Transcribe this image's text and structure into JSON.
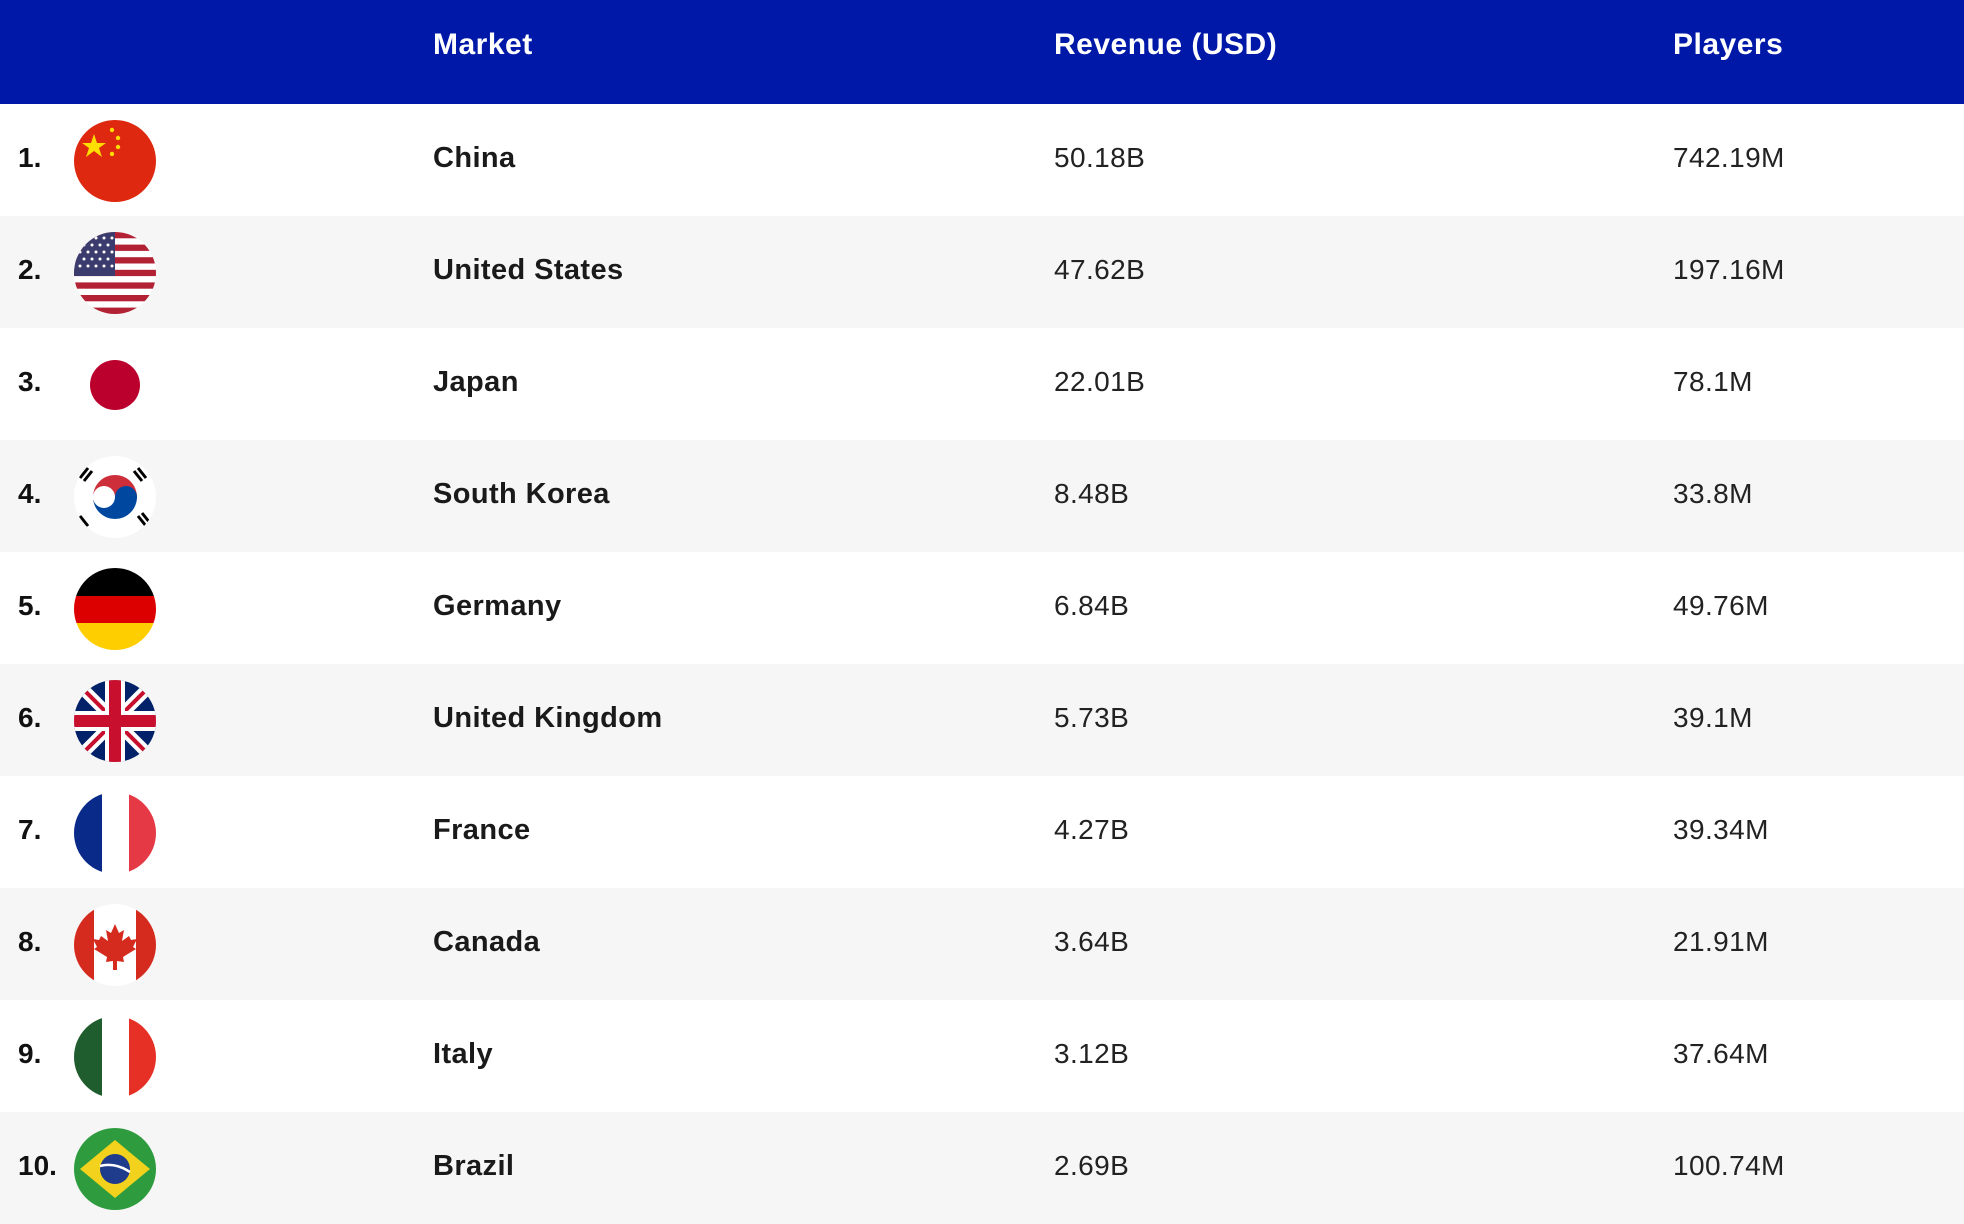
{
  "chart_data": {
    "type": "table",
    "columns": [
      "",
      "Market",
      "Revenue (USD)",
      "Players"
    ],
    "rows": [
      {
        "rank": "1.",
        "flag": "china-flag-icon",
        "market": "China",
        "revenue": "50.18B",
        "players": "742.19M"
      },
      {
        "rank": "2.",
        "flag": "united-states-flag-icon",
        "market": "United States",
        "revenue": "47.62B",
        "players": "197.16M"
      },
      {
        "rank": "3.",
        "flag": "japan-flag-icon",
        "market": "Japan",
        "revenue": "22.01B",
        "players": "78.1M"
      },
      {
        "rank": "4.",
        "flag": "south-korea-flag-icon",
        "market": "South Korea",
        "revenue": "8.48B",
        "players": "33.8M"
      },
      {
        "rank": "5.",
        "flag": "germany-flag-icon",
        "market": "Germany",
        "revenue": "6.84B",
        "players": "49.76M"
      },
      {
        "rank": "6.",
        "flag": "united-kingdom-flag-icon",
        "market": "United Kingdom",
        "revenue": "5.73B",
        "players": "39.1M"
      },
      {
        "rank": "7.",
        "flag": "france-flag-icon",
        "market": "France",
        "revenue": "4.27B",
        "players": "39.34M"
      },
      {
        "rank": "8.",
        "flag": "canada-flag-icon",
        "market": "Canada",
        "revenue": "3.64B",
        "players": "21.91M"
      },
      {
        "rank": "9.",
        "flag": "italy-flag-icon",
        "market": "Italy",
        "revenue": "3.12B",
        "players": "37.64M"
      },
      {
        "rank": "10.",
        "flag": "brazil-flag-icon",
        "market": "Brazil",
        "revenue": "2.69B",
        "players": "100.74M"
      }
    ],
    "colors": {
      "header_bg": "#0018a8",
      "header_text": "#ffffff",
      "alt_row_bg": "#f6f6f6"
    }
  }
}
